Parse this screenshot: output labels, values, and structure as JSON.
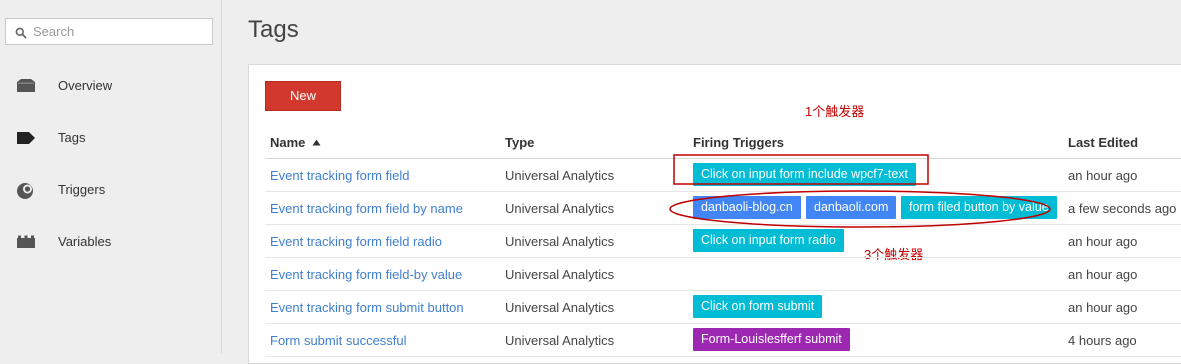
{
  "sidebar": {
    "search": {
      "placeholder": "Search",
      "value": ""
    },
    "items": [
      {
        "label": "Overview",
        "icon": "folder-icon"
      },
      {
        "label": "Tags",
        "icon": "tag-icon"
      },
      {
        "label": "Triggers",
        "icon": "trigger-icon"
      },
      {
        "label": "Variables",
        "icon": "variables-icon"
      }
    ]
  },
  "main": {
    "title": "Tags",
    "new_button": "New",
    "annotations": {
      "one_trigger": "1个触发器",
      "three_triggers": "3个触发器"
    },
    "table": {
      "headers": {
        "name": "Name",
        "type": "Type",
        "triggers": "Firing Triggers",
        "edited": "Last Edited"
      },
      "sort": {
        "column": "name",
        "direction": "ascending"
      },
      "rows": [
        {
          "name": "Event tracking form field",
          "type": "Universal Analytics",
          "triggers": [
            {
              "label": "Click on input form include wpcf7-text",
              "color": "#00bcd4"
            }
          ],
          "edited": "an hour ago"
        },
        {
          "name": "Event tracking form field by name",
          "type": "Universal Analytics",
          "triggers": [
            {
              "label": "danbaoli-blog.cn",
              "color": "#4285f4"
            },
            {
              "label": "danbaoli.com",
              "color": "#4285f4"
            },
            {
              "label": "form filed button by value",
              "color": "#00bcd4"
            }
          ],
          "edited": "a few seconds ago"
        },
        {
          "name": "Event tracking form field radio",
          "type": "Universal Analytics",
          "triggers": [
            {
              "label": "Click on input form radio",
              "color": "#00bcd4"
            }
          ],
          "edited": "an hour ago"
        },
        {
          "name": "Event tracking form field-by value",
          "type": "Universal Analytics",
          "triggers": [],
          "edited": "an hour ago"
        },
        {
          "name": "Event tracking form submit button",
          "type": "Universal Analytics",
          "triggers": [
            {
              "label": "Click on form submit",
              "color": "#00bcd4"
            }
          ],
          "edited": "an hour ago"
        },
        {
          "name": "Form submit successful",
          "type": "Universal Analytics",
          "triggers": [
            {
              "label": "Form-Louislesfferf submit",
              "color": "#9c27b0"
            }
          ],
          "edited": "4 hours ago"
        }
      ]
    }
  },
  "colors": {
    "new_button": "#d2382c",
    "link": "#3f7fce",
    "annotation": "#c00000"
  }
}
